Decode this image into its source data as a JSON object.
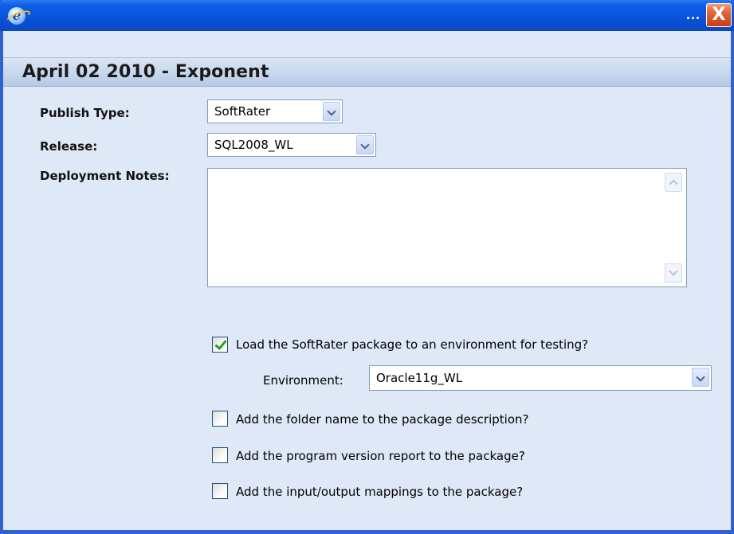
{
  "window": {
    "title_icon": "ie-icon",
    "dots": "...",
    "close_label": "X"
  },
  "page_title": "April 02 2010 - Exponent",
  "form": {
    "publish_type": {
      "label": "Publish Type:",
      "value": "SoftRater"
    },
    "release": {
      "label": "Release:",
      "value": "SQL2008_WL"
    },
    "deployment_notes": {
      "label": "Deployment Notes:",
      "value": ""
    },
    "load_package": {
      "label": "Load the SoftRater package to an environment for testing?",
      "checked": true
    },
    "environment": {
      "label": "Environment:",
      "value": "Oracle11g_WL"
    },
    "add_folder_name": {
      "label": "Add the folder name to the package description?",
      "checked": false
    },
    "add_program_version": {
      "label": "Add the program version report to the package?",
      "checked": false
    },
    "add_io_mappings": {
      "label": "Add the input/output mappings to the package?",
      "checked": false
    }
  },
  "colors": {
    "titlebar": "#0852d8",
    "window_border": "#2f62d0",
    "body_bg": "#dfe8f6",
    "close_button": "#cc3b14",
    "check_mark": "#21a121"
  }
}
